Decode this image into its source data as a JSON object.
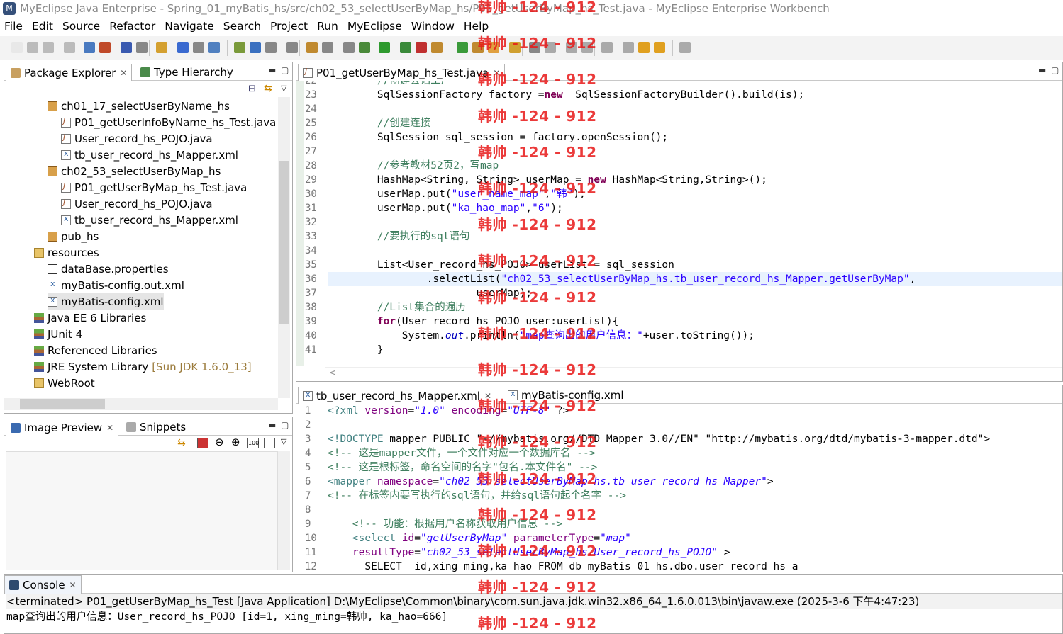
{
  "window": {
    "title": "MyEclipse Java Enterprise - Spring_01_myBatis_hs/src/ch02_53_selectUserByMap_hs/P01_getUserByMap_hs_Test.java - MyEclipse Enterprise Workbench"
  },
  "menu": [
    "File",
    "Edit",
    "Source",
    "Refactor",
    "Navigate",
    "Search",
    "Project",
    "Run",
    "MyEclipse",
    "Window",
    "Help"
  ],
  "explorer": {
    "tabs": [
      "Package Explorer",
      "Type Hierarchy"
    ],
    "items": [
      {
        "label": "ch01_17_selectUserByName_hs",
        "icon": "package-icon",
        "indent": 1
      },
      {
        "label": "P01_getUserInfoByName_hs_Test.java",
        "icon": "java-file-icon",
        "indent": 2
      },
      {
        "label": "User_record_hs_POJO.java",
        "icon": "java-file-icon",
        "indent": 2
      },
      {
        "label": "tb_user_record_hs_Mapper.xml",
        "icon": "xml-file-icon",
        "indent": 2
      },
      {
        "label": "ch02_53_selectUserByMap_hs",
        "icon": "package-icon",
        "indent": 1
      },
      {
        "label": "P01_getUserByMap_hs_Test.java",
        "icon": "java-file-icon",
        "indent": 2
      },
      {
        "label": "User_record_hs_POJO.java",
        "icon": "java-file-icon",
        "indent": 2
      },
      {
        "label": "tb_user_record_hs_Mapper.xml",
        "icon": "xml-file-icon",
        "indent": 2
      },
      {
        "label": "pub_hs",
        "icon": "package-icon",
        "indent": 1
      },
      {
        "label": "resources",
        "icon": "folder-icon",
        "indent": 0
      },
      {
        "label": "dataBase.properties",
        "icon": "properties-file-icon",
        "indent": 1
      },
      {
        "label": "myBatis-config.out.xml",
        "icon": "xml-file-icon",
        "indent": 1
      },
      {
        "label": "myBatis-config.xml",
        "icon": "xml-file-icon",
        "indent": 1
      },
      {
        "label": "Java EE 6 Libraries",
        "icon": "library-icon",
        "indent": 0
      },
      {
        "label": "JUnit 4",
        "icon": "library-icon",
        "indent": 0
      },
      {
        "label": "Referenced Libraries",
        "icon": "library-icon",
        "indent": 0
      },
      {
        "label": "JRE System Library",
        "icon": "library-icon",
        "indent": 0,
        "suffix": "[Sun JDK 1.6.0_13]"
      },
      {
        "label": "WebRoot",
        "icon": "folder-icon",
        "indent": 0
      }
    ]
  },
  "image_preview": {
    "tabs": [
      "Image Preview",
      "Snippets"
    ]
  },
  "editor_top": {
    "tab": "P01_getUserByMap_hs_Test.java",
    "lines": [
      {
        "n": "22",
        "t": "        //创建会话工厂"
      },
      {
        "n": "23",
        "t": "        SqlSessionFactory factory =new  SqlSessionFactoryBuilder().build(is);"
      },
      {
        "n": "24",
        "t": ""
      },
      {
        "n": "25",
        "t": "        //创建连接"
      },
      {
        "n": "26",
        "t": "        SqlSession sql_session = factory.openSession();"
      },
      {
        "n": "27",
        "t": ""
      },
      {
        "n": "28",
        "t": "        //参考教材52页2，写map"
      },
      {
        "n": "29",
        "t": "        HashMap<String, String> userMap = new HashMap<String,String>();"
      },
      {
        "n": "30",
        "t": "        userMap.put(\"user_name_map\",\"韩\");"
      },
      {
        "n": "31",
        "t": "        userMap.put(\"ka_hao_map\",\"6\");"
      },
      {
        "n": "32",
        "t": ""
      },
      {
        "n": "33",
        "t": "        //要执行的sql语句"
      },
      {
        "n": "34",
        "t": ""
      },
      {
        "n": "35",
        "t": "        List<User_record_hs_POJO> userList = sql_session"
      },
      {
        "n": "36",
        "t": "                .selectList(\"ch02_53_selectUserByMap_hs.tb_user_record_hs_Mapper.getUserByMap\","
      },
      {
        "n": "37",
        "t": "                        userMap);"
      },
      {
        "n": "38",
        "t": "        //List集合的遍历"
      },
      {
        "n": "39",
        "t": "        for(User_record_hs_POJO user:userList){"
      },
      {
        "n": "40",
        "t": "            System.out.println(\"map查询出的用户信息：\"+user.toString());"
      },
      {
        "n": "41",
        "t": "        }"
      }
    ]
  },
  "editor_bottom": {
    "tabs": [
      "tb_user_record_hs_Mapper.xml",
      "myBatis-config.xml"
    ],
    "lines": [
      {
        "n": "1",
        "t": "<?xml version=\"1.0\" encoding=\"UTF-8\" ?>"
      },
      {
        "n": "2",
        "t": ""
      },
      {
        "n": "3",
        "t": "<!DOCTYPE mapper PUBLIC \"-//mybatis.org//DTD Mapper 3.0//EN\" \"http://mybatis.org/dtd/mybatis-3-mapper.dtd\">"
      },
      {
        "n": "4",
        "t": "<!-- 这是mapper文件，一个文件对应一个数据库名 -->"
      },
      {
        "n": "5",
        "t": "<!-- 这是根标签，命名空间的名字\"包名.本文件名\" -->"
      },
      {
        "n": "6",
        "t": "<mapper namespace=\"ch02_53_selectUserByMap_hs.tb_user_record_hs_Mapper\">"
      },
      {
        "n": "7",
        "t": "<!-- 在标签内要写执行的sql语句，并给sql语句起个名字 -->"
      },
      {
        "n": "8",
        "t": ""
      },
      {
        "n": "9",
        "t": "    <!-- 功能：根据用户名称获取用户信息 -->"
      },
      {
        "n": "10",
        "t": "    <select id=\"getUserByMap\" parameterType=\"map\""
      },
      {
        "n": "11",
        "t": "    resultType=\"ch02_53_selectUserByMap_hs.User_record_hs_POJO\" >"
      },
      {
        "n": "12",
        "t": "      SELECT  id,xing_ming,ka_hao FROM db_myBatis_01_hs.dbo.user_record_hs a"
      }
    ]
  },
  "console": {
    "tab": "Console",
    "status": "<terminated> P01_getUserByMap_hs_Test [Java Application] D:\\MyEclipse\\Common\\binary\\com.sun.java.jdk.win32.x86_64_1.6.0.013\\bin\\javaw.exe (2025-3-6 下午4:47:23)",
    "output": "map查询出的用户信息：User_record_hs_POJO [id=1, xing_ming=韩帅, ka_hao=666]"
  },
  "watermark": "韩帅 -124 - 912"
}
